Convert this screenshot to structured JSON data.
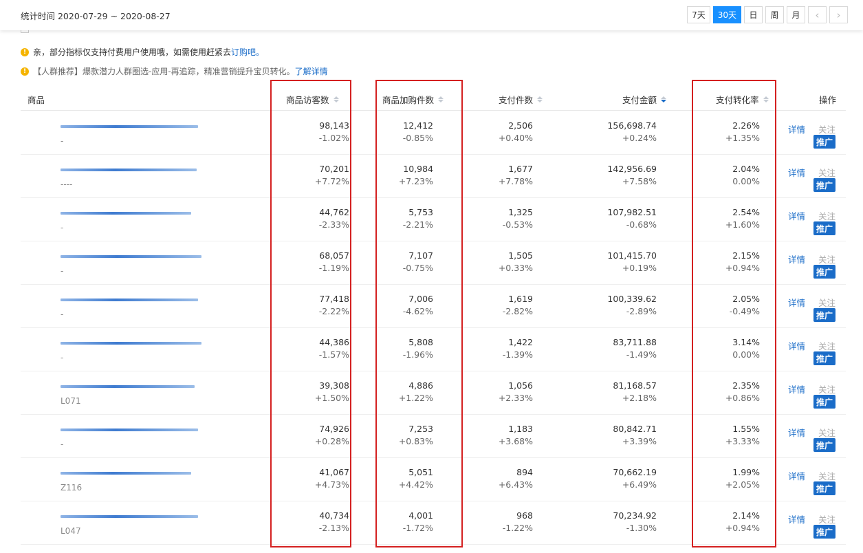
{
  "header": {
    "date_range": "统计时间 2020-07-29 ~ 2020-08-27",
    "periods": [
      "7天",
      "30天",
      "日",
      "周",
      "月"
    ],
    "active_period": "30天",
    "prev_icon": "chevron-left-icon",
    "next_icon": "chevron-right-icon"
  },
  "notices": {
    "n1_text": "亲，部分指标仅支持付费用户使用哦，如需使用赶紧去",
    "n1_link": "订购吧。",
    "n2_text": "【人群推荐】爆款潜力人群圈选-应用-再追踪，精准营销提升宝贝转化。",
    "n2_link": "了解详情",
    "icon": "exclamation-icon"
  },
  "columns": {
    "product": "商品",
    "visitors": "商品访客数",
    "cart": "商品加购件数",
    "paid_qty": "支付件数",
    "paid_amt": "支付金额",
    "conv": "支付转化率",
    "ops": "操作"
  },
  "actions": {
    "detail": "详情",
    "follow": "关注",
    "promote": "推广"
  },
  "colors": {
    "accent": "#1890ff",
    "link": "#1a6cc8",
    "highlight_box": "#d42020",
    "notice_icon": "#f5b400"
  },
  "rows": [
    {
      "code": "-",
      "visitors": "98,143",
      "visitors_chg": "-1.02%",
      "cart": "12,412",
      "cart_chg": "-0.85%",
      "qty": "2,506",
      "qty_chg": "+0.40%",
      "amt": "156,698.74",
      "amt_chg": "+0.24%",
      "conv": "2.26%",
      "conv_chg": "+1.35%"
    },
    {
      "code": "----",
      "visitors": "70,201",
      "visitors_chg": "+7.72%",
      "cart": "10,984",
      "cart_chg": "+7.23%",
      "qty": "1,677",
      "qty_chg": "+7.78%",
      "amt": "142,956.69",
      "amt_chg": "+7.58%",
      "conv": "2.04%",
      "conv_chg": "0.00%"
    },
    {
      "code": "-",
      "visitors": "44,762",
      "visitors_chg": "-2.33%",
      "cart": "5,753",
      "cart_chg": "-2.21%",
      "qty": "1,325",
      "qty_chg": "-0.53%",
      "amt": "107,982.51",
      "amt_chg": "-0.68%",
      "conv": "2.54%",
      "conv_chg": "+1.60%"
    },
    {
      "code": "-",
      "visitors": "68,057",
      "visitors_chg": "-1.19%",
      "cart": "7,107",
      "cart_chg": "-0.75%",
      "qty": "1,505",
      "qty_chg": "+0.33%",
      "amt": "101,415.70",
      "amt_chg": "+0.19%",
      "conv": "2.15%",
      "conv_chg": "+0.94%"
    },
    {
      "code": "-",
      "visitors": "77,418",
      "visitors_chg": "-2.22%",
      "cart": "7,006",
      "cart_chg": "-4.62%",
      "qty": "1,619",
      "qty_chg": "-2.82%",
      "amt": "100,339.62",
      "amt_chg": "-2.89%",
      "conv": "2.05%",
      "conv_chg": "-0.49%"
    },
    {
      "code": "-",
      "visitors": "44,386",
      "visitors_chg": "-1.57%",
      "cart": "5,808",
      "cart_chg": "-1.96%",
      "qty": "1,422",
      "qty_chg": "-1.39%",
      "amt": "83,711.88",
      "amt_chg": "-1.49%",
      "conv": "3.14%",
      "conv_chg": "0.00%"
    },
    {
      "code": "L071",
      "visitors": "39,308",
      "visitors_chg": "+1.50%",
      "cart": "4,886",
      "cart_chg": "+1.22%",
      "qty": "1,056",
      "qty_chg": "+2.33%",
      "amt": "81,168.57",
      "amt_chg": "+2.18%",
      "conv": "2.35%",
      "conv_chg": "+0.86%"
    },
    {
      "code": "-",
      "visitors": "74,926",
      "visitors_chg": "+0.28%",
      "cart": "7,253",
      "cart_chg": "+0.83%",
      "qty": "1,183",
      "qty_chg": "+3.68%",
      "amt": "80,842.71",
      "amt_chg": "+3.39%",
      "conv": "1.55%",
      "conv_chg": "+3.33%"
    },
    {
      "code": "Z116",
      "visitors": "41,067",
      "visitors_chg": "+4.73%",
      "cart": "5,051",
      "cart_chg": "+4.42%",
      "qty": "894",
      "qty_chg": "+6.43%",
      "amt": "70,662.19",
      "amt_chg": "+6.49%",
      "conv": "1.99%",
      "conv_chg": "+2.05%"
    },
    {
      "code": "L047",
      "visitors": "40,734",
      "visitors_chg": "-2.13%",
      "cart": "4,001",
      "cart_chg": "-1.72%",
      "qty": "968",
      "qty_chg": "-1.22%",
      "amt": "70,234.92",
      "amt_chg": "-1.30%",
      "conv": "2.14%",
      "conv_chg": "+0.94%"
    }
  ]
}
